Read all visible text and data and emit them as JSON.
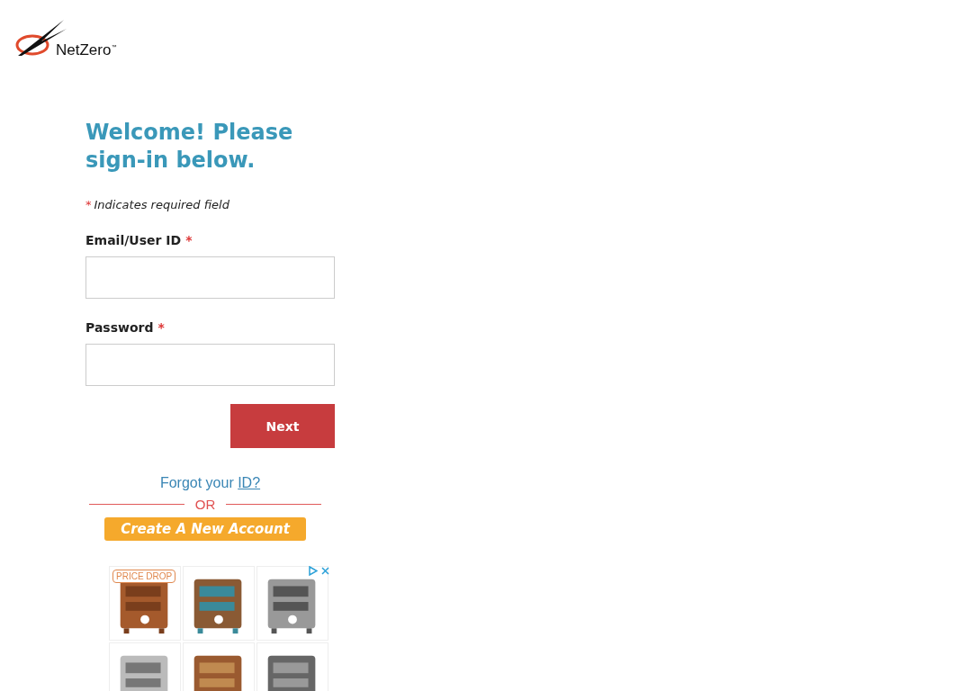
{
  "logo": {
    "text": "NetZero$^{™}$"
  },
  "heading": "Welcome! Please sign-in below.",
  "required_note": {
    "mark": "*",
    "text": "Indicates required field"
  },
  "fields": [
    {
      "label": "Email/User ID",
      "required_mark": "*"
    },
    {
      "label": "Password",
      "required_mark": "*"
    }
  ],
  "next_button": "Next",
  "forgot": {
    "text": "Forgot your",
    "link": "ID?"
  },
  "divider": "OR",
  "create_account_button": "Create A New Account",
  "ad": {
    "badge": "PRICE DROP"
  }
}
